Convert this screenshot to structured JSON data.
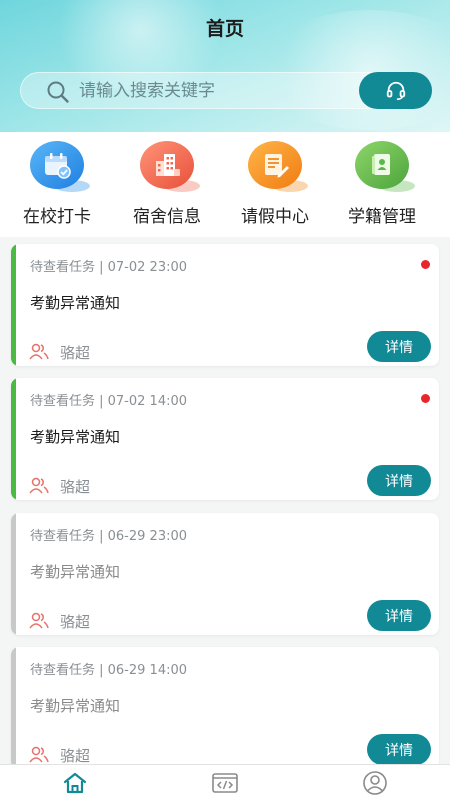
{
  "header": {
    "title": "首页"
  },
  "search": {
    "placeholder": "请输入搜索关键字",
    "service_icon": "headset-icon"
  },
  "quick_actions": [
    {
      "label": "在校打卡",
      "icon": "calendar-check-icon",
      "color": "#2a8fe8"
    },
    {
      "label": "宿舍信息",
      "icon": "building-icon",
      "color": "#ef6a50"
    },
    {
      "label": "请假中心",
      "icon": "document-edit-icon",
      "color": "#f08a1c"
    },
    {
      "label": "学籍管理",
      "icon": "student-record-icon",
      "color": "#5ab84a"
    }
  ],
  "tasks": [
    {
      "meta": "待查看任务 | 07-02 23:00",
      "title": "考勤异常通知",
      "assignee": "骆超",
      "button": "详情",
      "unread": true
    },
    {
      "meta": "待查看任务 | 07-02 14:00",
      "title": "考勤异常通知",
      "assignee": "骆超",
      "button": "详情",
      "unread": true
    },
    {
      "meta": "待查看任务 | 06-29 23:00",
      "title": "考勤异常通知",
      "assignee": "骆超",
      "button": "详情",
      "unread": false
    },
    {
      "meta": "待查看任务 | 06-29 14:00",
      "title": "考勤异常通知",
      "assignee": "骆超",
      "button": "详情",
      "unread": false
    }
  ],
  "colors": {
    "accent": "#128a96",
    "unread_bar": "#4cb944",
    "read_bar": "#c8c8c8",
    "unread_dot": "#e8262b"
  },
  "tab_bar": [
    {
      "icon": "home-icon",
      "active": true
    },
    {
      "icon": "code-icon",
      "active": false
    },
    {
      "icon": "user-icon",
      "active": false
    }
  ]
}
